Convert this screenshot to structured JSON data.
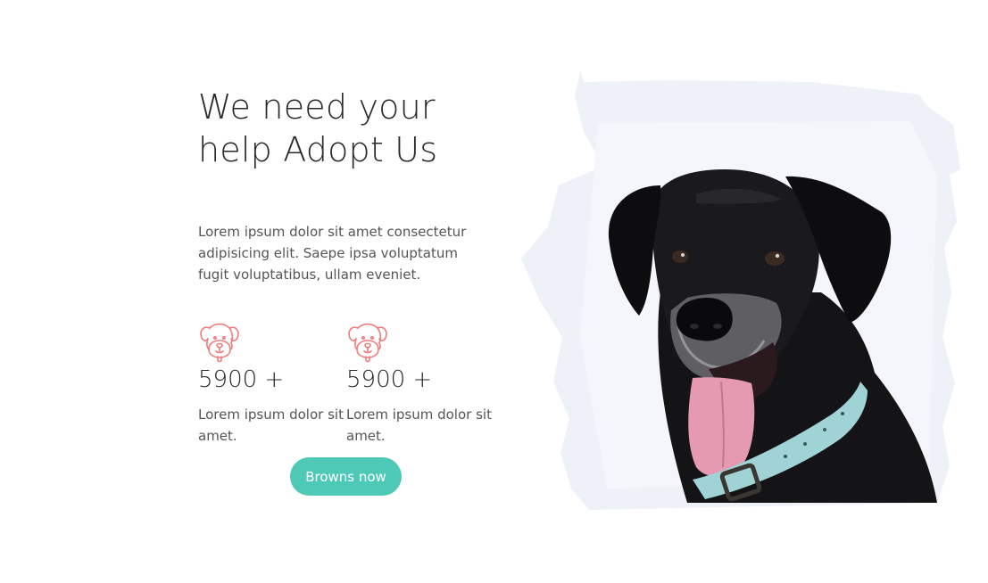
{
  "hero": {
    "title_line1": "We need your",
    "title_line2": "help Adopt Us",
    "description": "Lorem ipsum dolor sit amet consectetur adipisicing elit. Saepe ipsa voluptatum fugit voluptatibus, ullam eveniet."
  },
  "stats": [
    {
      "icon": "dog-face-icon",
      "value": "5900 +",
      "label": "Lorem ipsum dolor sit amet."
    },
    {
      "icon": "dog-face-icon",
      "value": "5900 +",
      "label": "Lorem ipsum dolor sit amet."
    }
  ],
  "cta": {
    "label": "Browns now"
  },
  "image": {
    "subject": "black-dog-photo"
  },
  "colors": {
    "accent": "#4ec9b8",
    "icon": "#f07c7c",
    "heading": "#2a2a2a",
    "body_text": "#555555",
    "photo_backdrop": "#eef1f8"
  }
}
